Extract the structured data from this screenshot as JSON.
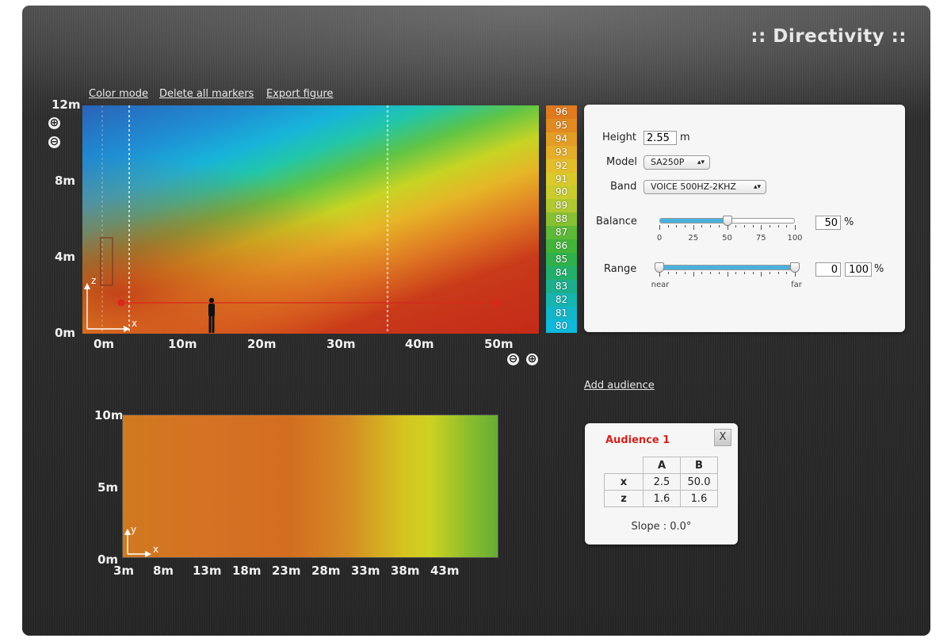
{
  "title": ":: Directivity ::",
  "toolbar": {
    "color_mode": "Color mode",
    "delete_markers": "Delete all markers",
    "export_figure": "Export figure"
  },
  "main_plot": {
    "y_ticks": [
      "12m",
      "8m",
      "4m",
      "0m"
    ],
    "x_ticks": [
      "0m",
      "10m",
      "20m",
      "30m",
      "40m",
      "50m"
    ],
    "axis_z": "z",
    "axis_x": "x",
    "zoom_in": "⊕",
    "zoom_out": "⊖"
  },
  "legend": {
    "values": [
      "96",
      "95",
      "94",
      "93",
      "92",
      "91",
      "90",
      "89",
      "88",
      "87",
      "86",
      "85",
      "84",
      "83",
      "82",
      "81",
      "80"
    ],
    "colors": [
      "#df7a1f",
      "#e08a22",
      "#e39c25",
      "#e4ae28",
      "#e2bf2a",
      "#d9c92b",
      "#c9cc2c",
      "#b2c82f",
      "#88c033",
      "#5db937",
      "#43b33a",
      "#2fb04b",
      "#23ae6a",
      "#1daf8d",
      "#17b3ae",
      "#13b6c6",
      "#10b8d9"
    ]
  },
  "settings": {
    "height_label": "Height",
    "height_value": "2.55",
    "height_unit": "m",
    "model_label": "Model",
    "model_value": "SA250P",
    "band_label": "Band",
    "band_value": "VOICE 500HZ-2KHZ",
    "balance_label": "Balance",
    "balance_value": "50",
    "balance_unit": "%",
    "balance_ticks": [
      "0",
      "25",
      "50",
      "75",
      "100"
    ],
    "range_label": "Range",
    "range_min": "0",
    "range_max": "100",
    "range_unit": "%",
    "range_near": "near",
    "range_far": "far"
  },
  "add_audience": "Add audience",
  "plan_plot": {
    "y_ticks": [
      "10m",
      "5m",
      "0m"
    ],
    "x_ticks": [
      "3m",
      "8m",
      "13m",
      "18m",
      "23m",
      "28m",
      "33m",
      "38m",
      "43m"
    ],
    "axis_y": "y",
    "axis_x": "x"
  },
  "audience": {
    "title": "Audience 1",
    "close": "X",
    "col_a": "A",
    "col_b": "B",
    "row_x": "x",
    "row_z": "z",
    "x_a": "2.5",
    "x_b": "50.0",
    "z_a": "1.6",
    "z_b": "1.6",
    "slope": "Slope : 0.0°"
  }
}
